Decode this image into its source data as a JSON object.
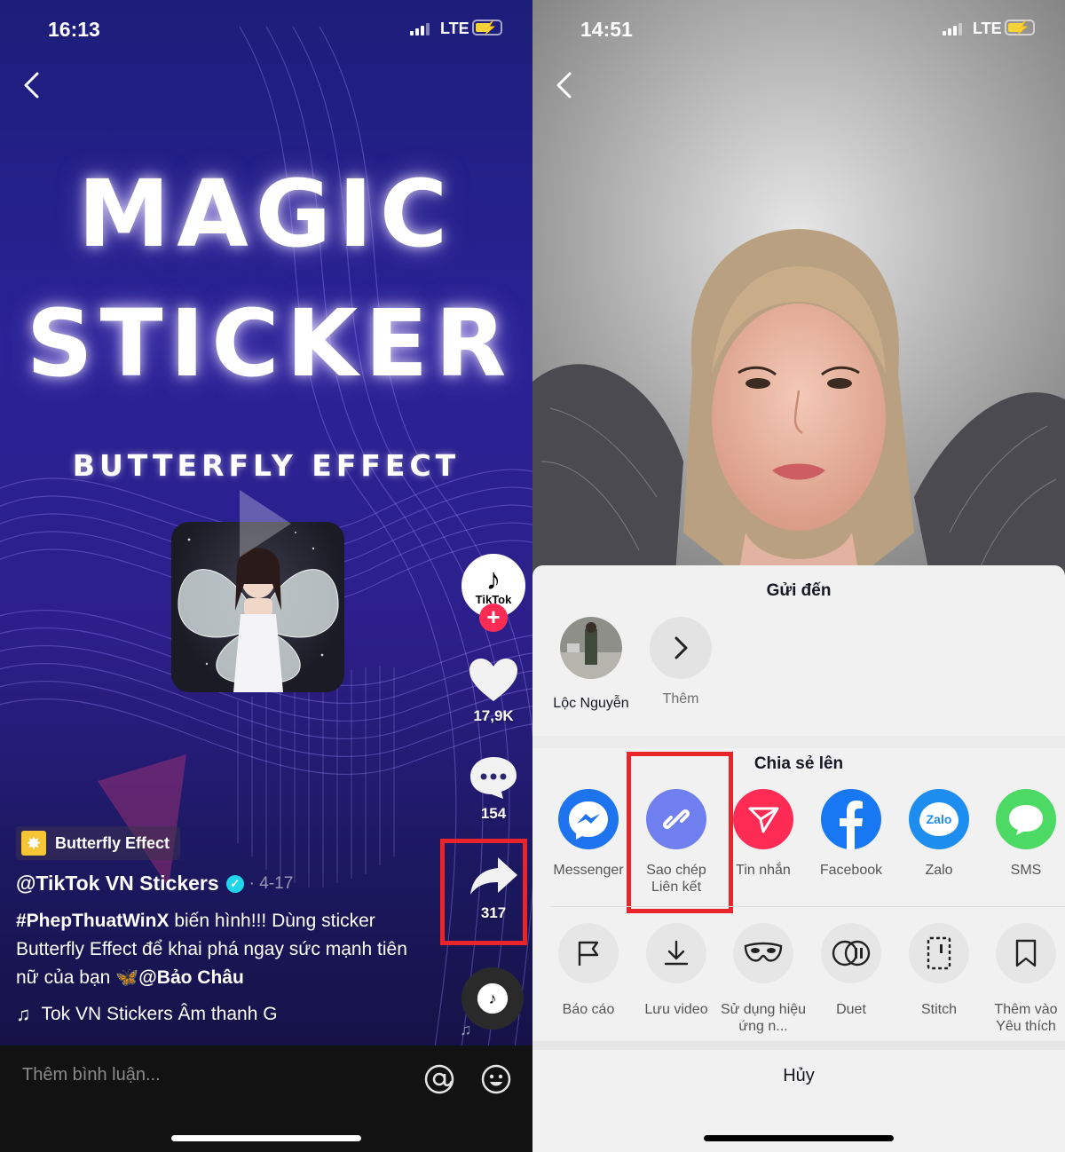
{
  "left": {
    "status": {
      "time": "16:13",
      "network": "LTE"
    },
    "video_title_line1": "MAGIC",
    "video_title_line2": "STICKER",
    "video_subtitle": "BUTTERFLY EFFECT",
    "avatar_word": "TikTok",
    "like_count": "17,9K",
    "comment_count": "154",
    "share_count": "317",
    "effect_label": "Butterfly Effect",
    "username": "@TikTok VN Stickers",
    "post_date": "· 4-17",
    "caption_hashtag": "#PhepThuatWinX",
    "caption_rest_1": " biến hình!!! Dùng sticker",
    "caption_line2": "Butterfly Effect để khai phá ngay sức mạnh tiên",
    "caption_line3_a": "nữ của bạn ",
    "caption_mention": "@Bảo Châu",
    "music_text": "Tok VN Stickers Âm thanh G",
    "comment_placeholder": "Thêm bình luận...",
    "highlight_color": "#e8252b"
  },
  "right": {
    "status": {
      "time": "14:51",
      "network": "LTE"
    },
    "send_to_title": "Gửi đến",
    "contacts": [
      {
        "name": "Lộc Nguyễn"
      },
      {
        "name": "Thêm"
      }
    ],
    "share_to_title": "Chia sẻ lên",
    "share_apps": [
      {
        "label": "Messenger",
        "color": "#1877f2"
      },
      {
        "label": "Sao chép Liên kết",
        "color": "#6d7df0"
      },
      {
        "label": "Tin nhắn",
        "color": "#fe2c55"
      },
      {
        "label": "Facebook",
        "color": "#1877f2"
      },
      {
        "label": "Zalo",
        "color": "#1d8ef0"
      },
      {
        "label": "SMS",
        "color": "#4cd964"
      }
    ],
    "actions": [
      {
        "label": "Báo cáo",
        "icon": "flag-icon"
      },
      {
        "label": "Lưu video",
        "icon": "download-icon"
      },
      {
        "label": "Sử dụng hiệu ứng n...",
        "icon": "mask-icon"
      },
      {
        "label": "Duet",
        "icon": "duet-icon"
      },
      {
        "label": "Stitch",
        "icon": "stitch-icon"
      },
      {
        "label": "Thêm vào Yêu thích",
        "icon": "bookmark-icon"
      }
    ],
    "cancel_label": "Hủy",
    "zalo_text": "Zalo"
  }
}
